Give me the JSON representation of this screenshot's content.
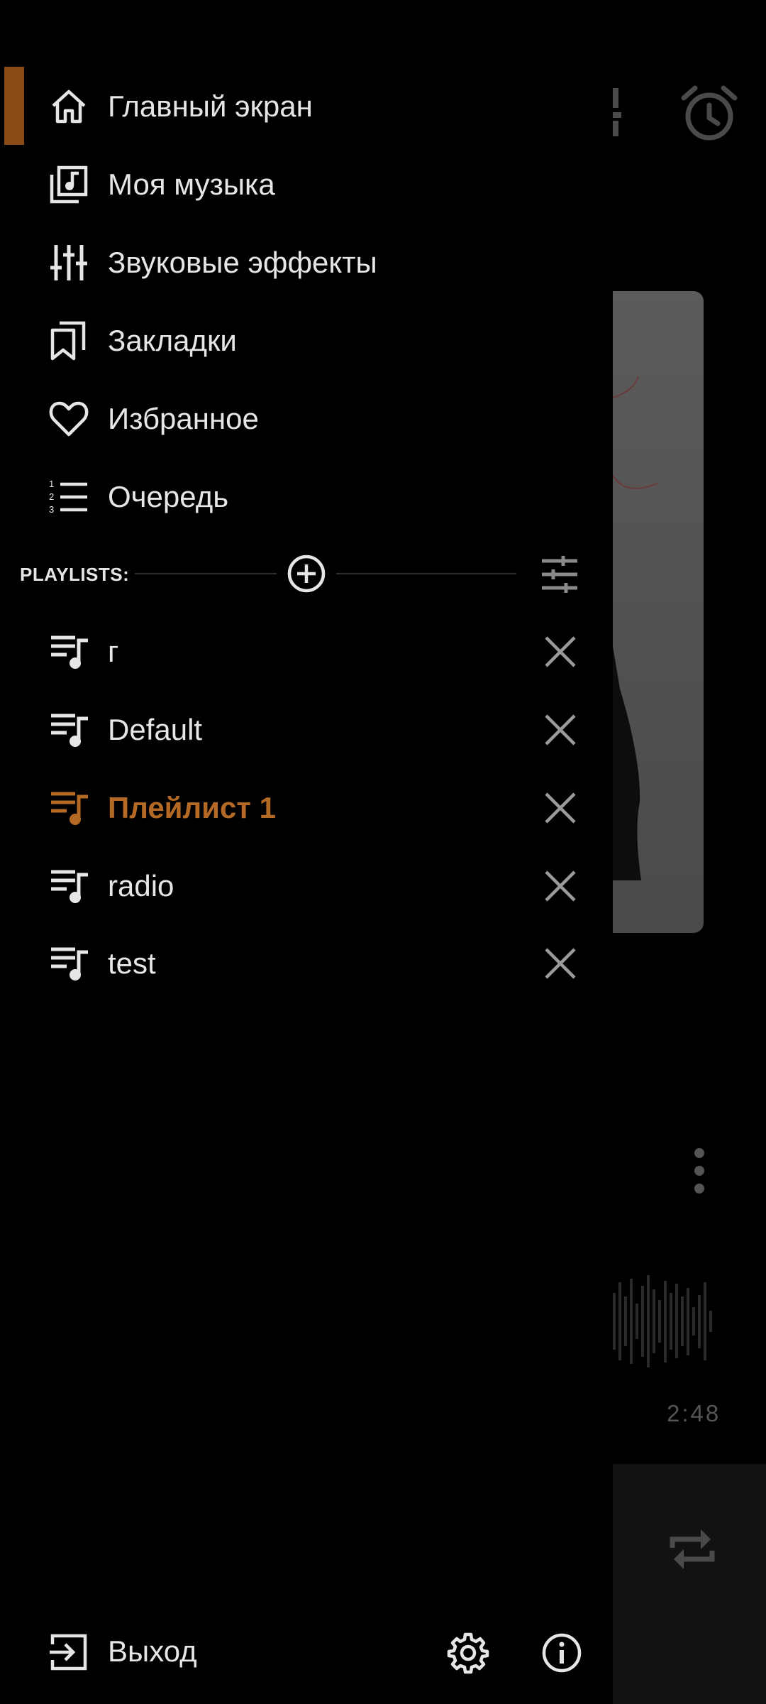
{
  "colors": {
    "accent": "#b46a25",
    "active_bar": "#8a4c14",
    "background": "#000000",
    "text": "#e6e6e6"
  },
  "menu": [
    {
      "label": "Главный экран",
      "icon": "home-icon",
      "active": true
    },
    {
      "label": "Моя музыка",
      "icon": "music-library-icon"
    },
    {
      "label": "Звуковые эффекты",
      "icon": "equalizer-icon"
    },
    {
      "label": "Закладки",
      "icon": "bookmarks-icon"
    },
    {
      "label": "Избранное",
      "icon": "heart-icon"
    },
    {
      "label": "Очередь",
      "icon": "queue-list-icon"
    }
  ],
  "playlists": {
    "title": "PLAYLISTS:",
    "add_icon": "add-circle-icon",
    "filter_icon": "tune-icon",
    "items": [
      {
        "label": "г",
        "icon": "playlist-icon"
      },
      {
        "label": "Default",
        "icon": "playlist-icon"
      },
      {
        "label": "Плейлист 1",
        "icon": "playlist-icon",
        "active": true
      },
      {
        "label": "radio",
        "icon": "playlist-icon"
      },
      {
        "label": "test",
        "icon": "playlist-icon"
      }
    ]
  },
  "footer": {
    "exit_label": "Выход",
    "exit_icon": "exit-icon",
    "settings_icon": "gear-icon",
    "info_icon": "info-icon"
  },
  "background_player": {
    "time": "2:48"
  }
}
